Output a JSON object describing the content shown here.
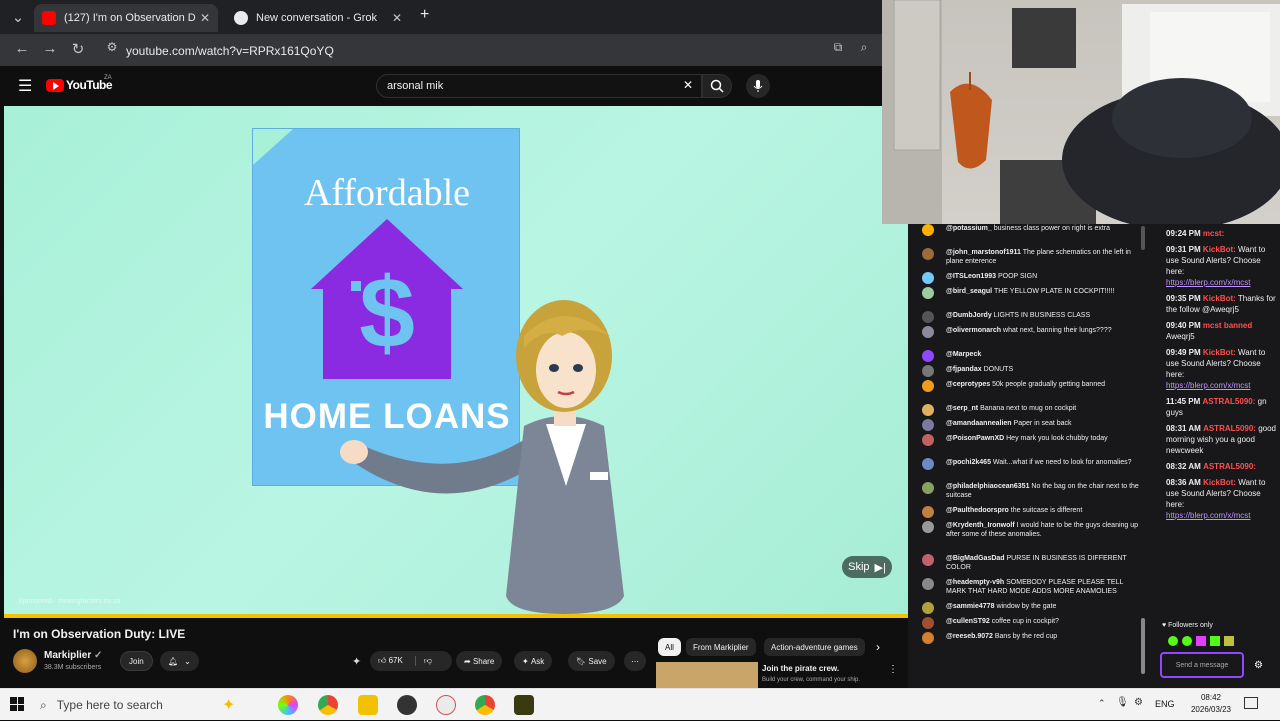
{
  "browser": {
    "tabs": [
      {
        "label": "(127) I'm on Observation D",
        "active": true
      },
      {
        "label": "New conversation - Grok",
        "active": false
      }
    ],
    "new_tab": "+",
    "url": "youtube.com/watch?v=RPRx161QoYQ"
  },
  "youtube": {
    "logo": "YouTube",
    "logo_region": "ZA",
    "search_value": "arsonal mik"
  },
  "video": {
    "poster_title": "Affordable",
    "poster_loans": "HOME LOANS",
    "skip_label": "Skip",
    "sponsored_label": "Sponsored · movingfactors.co.za",
    "progress_fraction": 1.0
  },
  "below": {
    "title": "I'm on Observation Duty: LIVE",
    "channel": "Markiplier",
    "subscribers": "38.3M subscribers",
    "join": "Join",
    "likes": "67K",
    "share": "Share",
    "ask": "Ask",
    "save": "Save",
    "chips": [
      "All",
      "From Markiplier",
      "Action-adventure games"
    ],
    "rec_title": "Join the pirate crew.",
    "rec_sub": "Build your crew, command your ship."
  },
  "chat_left": [
    {
      "user": "@potassium_",
      "text": "business class power on right is extra",
      "color": "#ffb000"
    },
    {
      "user": "@john_marstonof1911",
      "text": "The plane schematics on the left in plane enterence",
      "color": "#9b6a3a"
    },
    {
      "user": "@ITSLeon1993",
      "text": "POOP SIGN",
      "color": "#74c8ff"
    },
    {
      "user": "@bird_seagul",
      "text": "THE YELLOW PLATE IN COCKPIT!!!!!",
      "color": "#9ccba0"
    },
    {
      "user": "@DumbJordy",
      "text": "LIGHTS IN BUSINESS CLASS",
      "color": "#555555"
    },
    {
      "user": "@olivermonarch",
      "text": "what next, banning their lungs????",
      "color": "#8a8a9a"
    },
    {
      "user": "@Marpeck",
      "text": "",
      "color": "#9147ff"
    },
    {
      "user": "@fjpandax",
      "text": "DONUTS",
      "color": "#777777"
    },
    {
      "user": "@ceprotypes",
      "text": "50k people gradually getting banned",
      "color": "#f29a1b"
    },
    {
      "user": "@serp_nt",
      "text": "Banana next to mug on cockpit",
      "color": "#e0b060"
    },
    {
      "user": "@amandaannealien",
      "text": "Paper in seat back",
      "color": "#7a7aa0"
    },
    {
      "user": "@PoisonPawnXD",
      "text": "Hey mark you look chubby today",
      "color": "#c06060"
    },
    {
      "user": "@pochi2k465",
      "text": "Wait...what if we need to look for anomalies?",
      "color": "#6a8ac0"
    },
    {
      "user": "@philadelphiaocean6351",
      "text": "No the bag on the chair next to the suitcase",
      "color": "#8aa060"
    },
    {
      "user": "@Paulthedoorspro",
      "text": "the suitcase is different",
      "color": "#c08040"
    },
    {
      "user": "@Krydenth_Ironwolf",
      "text": "I would hate to be the guys cleaning up after some of these anomalies.",
      "color": "#999999"
    },
    {
      "user": "@BigMadGasDad",
      "text": "PURSE IN BUSINESS IS DIFFERENT COLOR",
      "color": "#c06070"
    },
    {
      "user": "@headempty-v9h",
      "text": "SOMEBODY PLEASE PLEASE TELL MARK THAT HARD MODE ADDS MORE ANAMOLIES",
      "color": "#888888"
    },
    {
      "user": "@sammie4778",
      "text": "window by the gate",
      "color": "#b0a040"
    },
    {
      "user": "@cullenST92",
      "text": "coffee cup in cockpit?",
      "color": "#a05030"
    },
    {
      "user": "@reeseb.9072",
      "text": "Bans by the red cup",
      "color": "#d08030"
    }
  ],
  "chat_right": [
    {
      "time": "09:24 PM",
      "user": "mcst:",
      "text": ""
    },
    {
      "time": "09:31 PM",
      "user": "KickBot:",
      "text": "Want to use Sound Alerts? Choose here:",
      "link": "https://blerp.com/x/mcst"
    },
    {
      "time": "09:35 PM",
      "user": "KickBot:",
      "text": "Thanks for the follow @Aweqrj5"
    },
    {
      "time": "09:40 PM",
      "user": "mcst banned",
      "text": "Aweqrj5"
    },
    {
      "time": "09:49 PM",
      "user": "KickBot:",
      "text": "Want to use Sound Alerts? Choose here:",
      "link": "https://blerp.com/x/mcst"
    },
    {
      "time": "11:45 PM",
      "user": "ASTRAL5090:",
      "text": "gn guys"
    },
    {
      "time": "08:31 AM",
      "user": "ASTRAL5090:",
      "text": "good morning wish you a good newcweek"
    },
    {
      "time": "08:32 AM",
      "user": "ASTRAL5090:",
      "text": ""
    },
    {
      "time": "08:36 AM",
      "user": "KickBot:",
      "text": "Want to use Sound Alerts? Choose here:",
      "link": "https://blerp.com/x/mcst"
    }
  ],
  "chat_footer": {
    "followers_only": "Followers only",
    "send_placeholder": "Send a message"
  },
  "taskbar": {
    "search_placeholder": "Type here to search",
    "lang": "ENG",
    "time": "08:42",
    "date": "2026/03/23"
  },
  "colors": {
    "yt_red": "#ff0000",
    "progress": "#f2c200",
    "house_purple": "#8a2be2",
    "kick_green": "#53fc18"
  }
}
